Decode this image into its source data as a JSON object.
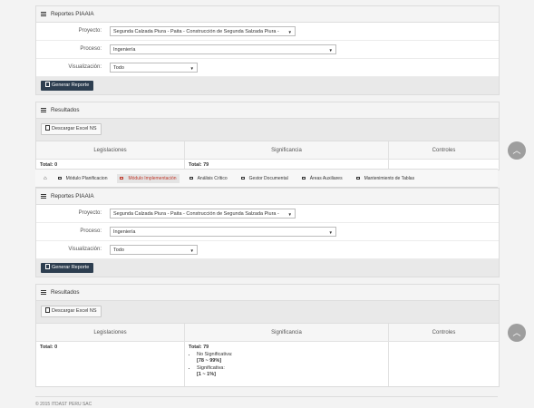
{
  "nav": {
    "items": [
      {
        "label": "Módulo Planificacion"
      },
      {
        "label": "Módulo Implementación"
      },
      {
        "label": "Análisis Crítico"
      },
      {
        "label": "Gestor Documental"
      },
      {
        "label": "Áreas Auxiliares"
      },
      {
        "label": "Mantenimiento de Tablas"
      }
    ],
    "active_color": "#c0392b"
  },
  "reportes": {
    "title": "Reportes PIAAIA",
    "proyecto_label": "Proyecto:",
    "proyecto_value": "Segunda Calzada Piura - Paita - Construcción de Segunda Salzada Piura -",
    "proceso_label": "Proceso:",
    "proceso_value": "Ingeniería",
    "visualizacion_label": "Visualización:",
    "visualizacion_value": "Todo",
    "generar_label": "Generar Reporte"
  },
  "resultados": {
    "title": "Resultados",
    "descargar_label": "Descargar Excel NS",
    "columns": [
      "Legislaciones",
      "Significancia",
      "Controles"
    ],
    "total_legislaciones": "Total: 0",
    "total_significancia": "Total: 79",
    "no_significativa_label": "No Significativa:",
    "no_significativa_range": "[78 ~ 99%]",
    "significativa_label": "Significativa:",
    "significativa_range": "[1 ~ 1%]"
  },
  "footer": {
    "copyright": "© 2015 ITDAST PERU SAC"
  },
  "colors": {
    "primary_button": "#2d3e50",
    "scroll_button": "#9e9e9e"
  }
}
